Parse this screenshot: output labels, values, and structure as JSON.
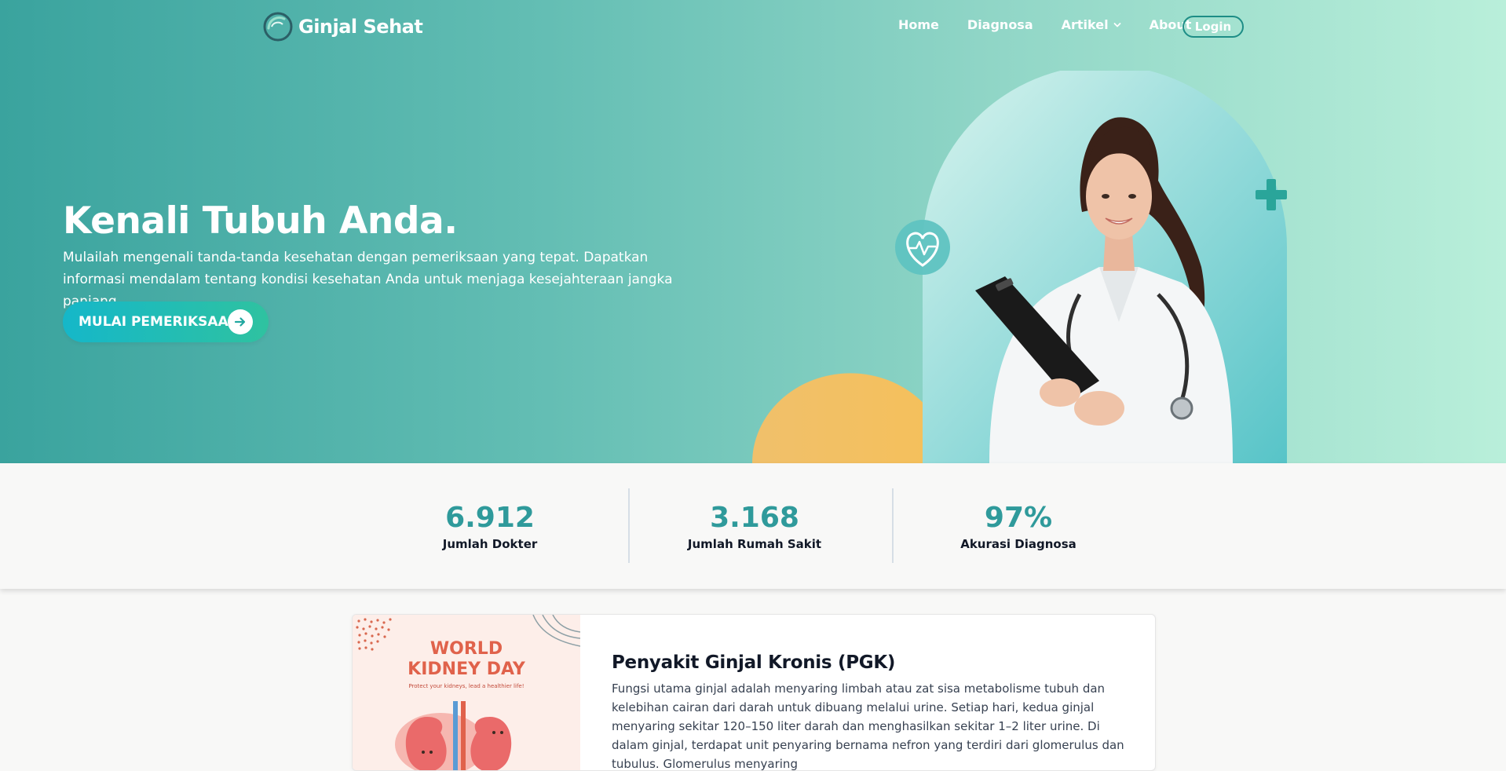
{
  "brand": {
    "name": "Ginjal Sehat",
    "logo_icon": "kidney-circle-logo"
  },
  "nav": {
    "links": [
      {
        "label": "Home"
      },
      {
        "label": "Diagnosa"
      },
      {
        "label": "Artikel",
        "has_dropdown": true
      },
      {
        "label": "About"
      }
    ],
    "login_label": "Login"
  },
  "hero": {
    "title": "Kenali Tubuh Anda.",
    "description": "Mulailah mengenali tanda-tanda kesehatan dengan pemeriksaan yang tepat. Dapatkan informasi mendalam tentang kondisi kesehatan Anda untuk menjaga kesejahteraan jangka panjang.",
    "cta_label": "MULAI PEMERIKSAAN",
    "cta_icon": "arrow-right-icon",
    "image_icons": [
      "heart-pulse-icon",
      "medical-cross-icon"
    ]
  },
  "stats": [
    {
      "value": "6.912",
      "label": "Jumlah Dokter"
    },
    {
      "value": "3.168",
      "label": "Jumlah Rumah Sakit"
    },
    {
      "value": "97%",
      "label": "Akurasi Diagnosa"
    }
  ],
  "article": {
    "image": {
      "title": "WORLD KIDNEY DAY",
      "title_line1": "WORLD",
      "title_line2": "KIDNEY DAY",
      "subtitle": "Protect your kidneys, lead a healthier life!"
    },
    "title": "Penyakit Ginjal Kronis (PGK)",
    "text": "Fungsi utama ginjal adalah menyaring limbah atau zat sisa metabolisme tubuh dan kelebihan cairan dari darah untuk dibuang melalui urine. Setiap hari, kedua ginjal menyaring sekitar 120–150 liter darah dan menghasilkan sekitar 1–2 liter urine. Di dalam ginjal, terdapat unit penyaring bernama nefron yang terdiri dari glomerulus dan tubulus. Glomerulus menyaring"
  },
  "colors": {
    "hero_start": "#3aa39e",
    "hero_end": "#b9efda",
    "accent": "#2f9a9b",
    "cta_start": "#15b7c9",
    "cta_end": "#2fc2a0"
  }
}
